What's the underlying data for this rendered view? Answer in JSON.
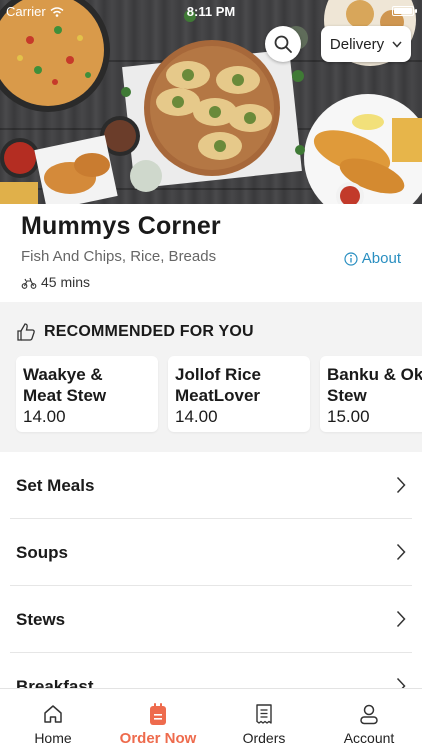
{
  "status_bar": {
    "carrier": "Carrier",
    "time": "8:11 PM"
  },
  "header": {
    "search_icon": "search-icon",
    "delivery_label": "Delivery"
  },
  "restaurant": {
    "name": "Mummys Corner",
    "cuisine": "Fish And Chips, Rice, Breads",
    "about_label": "About",
    "eta": "45 mins"
  },
  "recommended": {
    "title": "RECOMMENDED FOR YOU",
    "items": [
      {
        "name": "Waakye &\nMeat Stew",
        "price": "14.00"
      },
      {
        "name": "Jollof Rice\nMeatLover",
        "price": "14.00"
      },
      {
        "name": "Banku & Okro\nStew",
        "price": "15.00"
      }
    ]
  },
  "menu": {
    "categories": [
      "Set Meals",
      "Soups",
      "Stews",
      "Breakfast"
    ]
  },
  "tabbar": {
    "tabs": [
      {
        "label": "Home",
        "icon": "home-icon",
        "active": false
      },
      {
        "label": "Order Now",
        "icon": "order-icon",
        "active": true
      },
      {
        "label": "Orders",
        "icon": "receipt-icon",
        "active": false
      },
      {
        "label": "Account",
        "icon": "account-icon",
        "active": false
      }
    ]
  },
  "colors": {
    "accent": "#ee6b4d",
    "link": "#2a8fc1",
    "section_bg": "#f3f3f3"
  }
}
